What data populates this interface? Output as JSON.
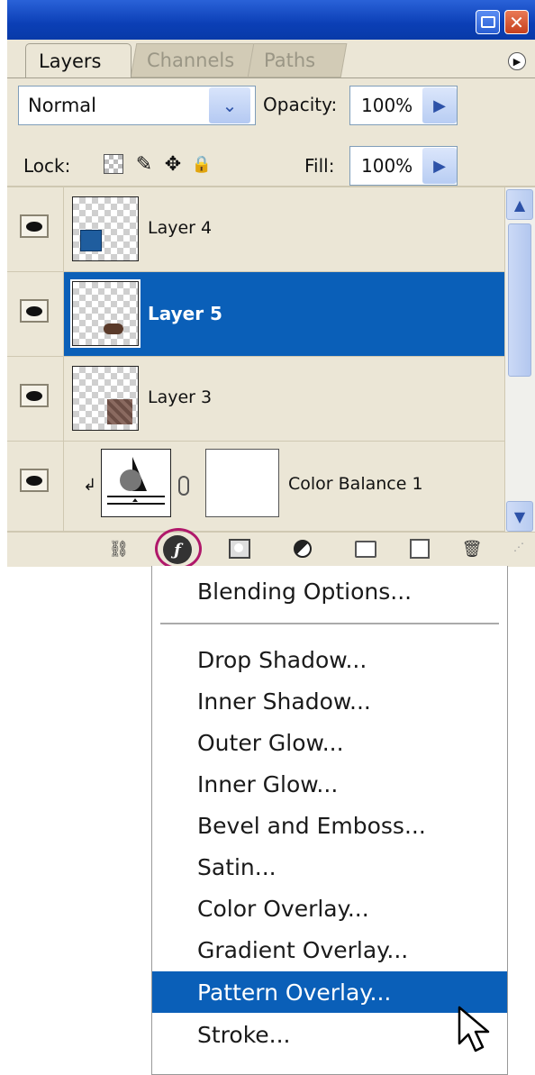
{
  "panel": {
    "tabs": [
      {
        "label": "Layers",
        "active": true
      },
      {
        "label": "Channels",
        "active": false
      },
      {
        "label": "Paths",
        "active": false
      }
    ],
    "blend_mode": "Normal",
    "opacity_label": "Opacity:",
    "opacity_value": "100%",
    "lock_label": "Lock:",
    "fill_label": "Fill:",
    "fill_value": "100%",
    "layers": [
      {
        "name": "Layer 4",
        "visible": true,
        "selected": false
      },
      {
        "name": "Layer 5",
        "visible": true,
        "selected": true
      },
      {
        "name": "Layer 3",
        "visible": true,
        "selected": false
      },
      {
        "name": "Color Balance 1",
        "visible": true,
        "selected": false,
        "clipped": true
      }
    ],
    "colors": {
      "selection": "#0a5fb8",
      "titlebar": "#0b3fb6",
      "panel_bg": "#ebe6d6",
      "highlight_ring": "#b0186a"
    }
  },
  "menu": {
    "items": [
      {
        "label": "Blending Options..."
      },
      {
        "label": "Drop Shadow..."
      },
      {
        "label": "Inner Shadow..."
      },
      {
        "label": "Outer Glow..."
      },
      {
        "label": "Inner Glow..."
      },
      {
        "label": "Bevel and Emboss..."
      },
      {
        "label": "Satin..."
      },
      {
        "label": "Color Overlay..."
      },
      {
        "label": "Gradient Overlay..."
      },
      {
        "label": "Pattern Overlay...",
        "highlighted": true
      },
      {
        "label": "Stroke..."
      }
    ]
  },
  "icons": {
    "close": "✕",
    "panel_menu": "▶",
    "dropdown_arrow": "⌄",
    "stepper_arrow": "▶",
    "paint_brush": "✎",
    "move": "✥",
    "lock": "🔒",
    "scroll_up": "▲",
    "scroll_down": "▼",
    "clip": "↲",
    "link_layers": "⛓",
    "fx": "ƒ",
    "trash": "🗑",
    "resize_grip": "⋰"
  }
}
